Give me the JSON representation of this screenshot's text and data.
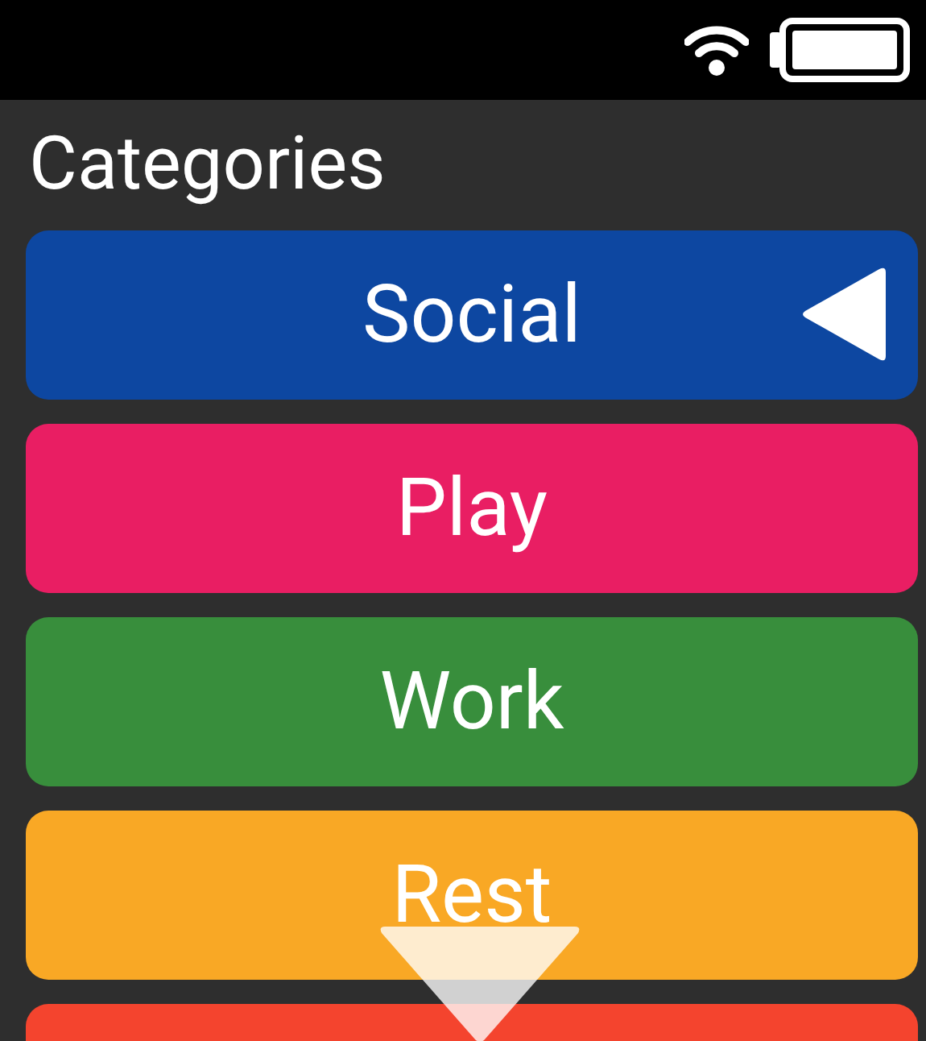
{
  "title": "Categories",
  "categories": [
    {
      "label": "Social",
      "color": "#0d47a1",
      "selected": true
    },
    {
      "label": "Play",
      "color": "#e91e63",
      "selected": false
    },
    {
      "label": "Work",
      "color": "#388e3c",
      "selected": false
    },
    {
      "label": "Rest",
      "color": "#f9a825",
      "selected": false
    },
    {
      "color": "#f4442e"
    }
  ]
}
